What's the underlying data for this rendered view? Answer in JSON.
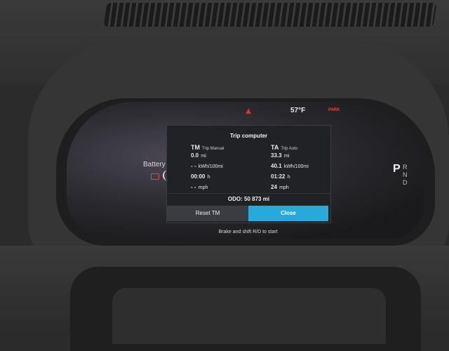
{
  "status": {
    "temperature": "57°F",
    "park_label": "PARK",
    "warning_icon": "warning-triangle-icon"
  },
  "side": {
    "battery_label": "Battery",
    "gear_selected": "P",
    "gear_others": [
      "R",
      "N",
      "D"
    ]
  },
  "trip_computer": {
    "title": "Trip computer",
    "manual": {
      "code": "TM",
      "name": "Trip Manual",
      "rows": [
        {
          "value": "0.0",
          "unit": "mi"
        },
        {
          "value": "- -",
          "unit": "kWh/100mi"
        },
        {
          "value": "00:00",
          "unit": "h"
        },
        {
          "value": "- -",
          "unit": "mph"
        }
      ]
    },
    "auto": {
      "code": "TA",
      "name": "Trip Auto",
      "rows": [
        {
          "value": "33.3",
          "unit": "mi"
        },
        {
          "value": "40.1",
          "unit": "kWh/100mi"
        },
        {
          "value": "01:22",
          "unit": "h"
        },
        {
          "value": "24",
          "unit": "mph"
        }
      ]
    },
    "odo_label": "ODO:",
    "odo_value": "50 873",
    "odo_unit": "mi",
    "reset_button": "Reset TM",
    "close_button": "Close"
  },
  "hint": "Brake and shift R/D to start",
  "colors": {
    "accent": "#27a9d9",
    "warning": "#e0332d"
  }
}
